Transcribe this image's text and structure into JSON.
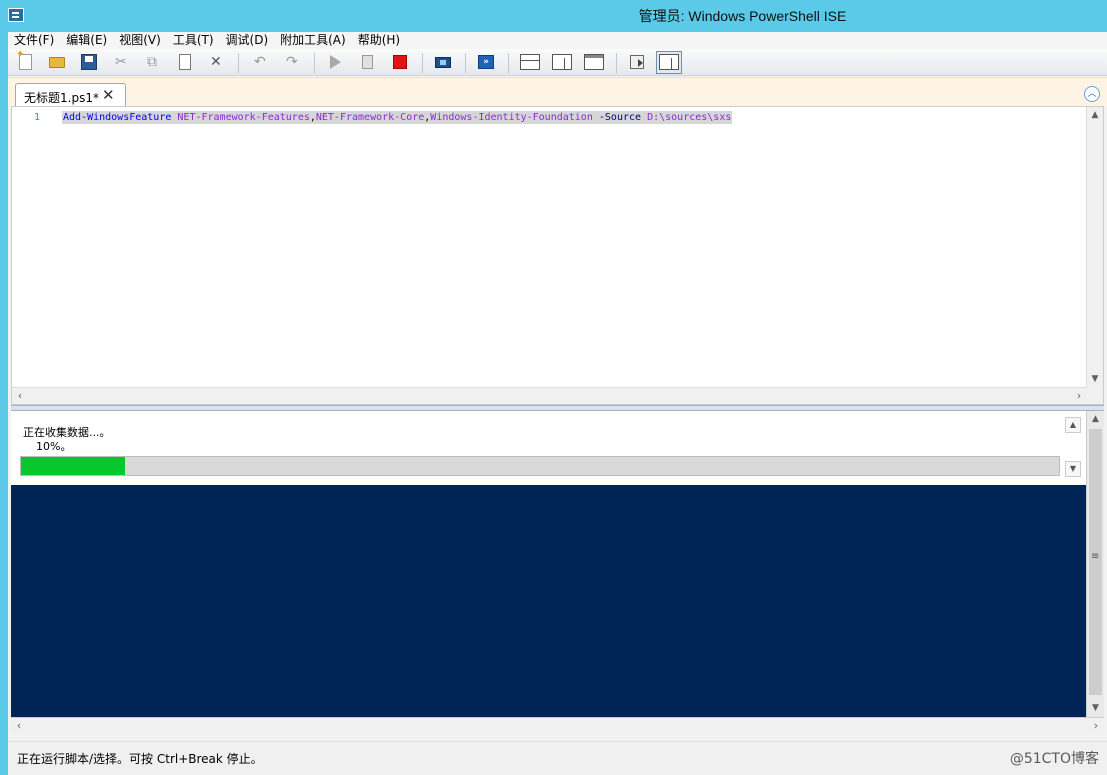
{
  "window": {
    "title": "管理员: Windows PowerShell ISE"
  },
  "menu": {
    "items": [
      {
        "label": "文件(F)"
      },
      {
        "label": "编辑(E)"
      },
      {
        "label": "视图(V)"
      },
      {
        "label": "工具(T)"
      },
      {
        "label": "调试(D)"
      },
      {
        "label": "附加工具(A)"
      },
      {
        "label": "帮助(H)"
      }
    ]
  },
  "toolbar": {
    "buttons": [
      "new-icon",
      "open-folder-icon",
      "save-icon",
      "cut-icon",
      "copy-icon",
      "paste-icon",
      "clear-icon",
      "undo-icon",
      "redo-icon",
      "run-icon",
      "run-selection-icon",
      "stop-icon",
      "remote-powershell-icon",
      "powershell-icon",
      "show-script-pane-top-icon",
      "show-script-pane-right-icon",
      "show-script-pane-max-icon",
      "command-addon-icon",
      "show-command-window-icon"
    ]
  },
  "tabs": [
    {
      "label": "无标题1.ps1*",
      "active": true
    }
  ],
  "editor": {
    "line_number": "1",
    "tokens": {
      "cmd": "Add-WindowsFeature",
      "arg1": "NET-Framework-Features",
      "arg2": "NET-Framework-Core",
      "arg3": "Windows-Identity-Foundation",
      "param": "-Source",
      "path": "D:\\sources\\sxs"
    }
  },
  "progress": {
    "activity": "正在收集数据...。",
    "percent_text": "10%。",
    "percent": 10,
    "fill_color": "#06c72d"
  },
  "console": {
    "background": "#012456"
  },
  "status": {
    "text": "正在运行脚本/选择。可按 Ctrl+Break 停止。",
    "watermark": "@51CTO博客"
  }
}
